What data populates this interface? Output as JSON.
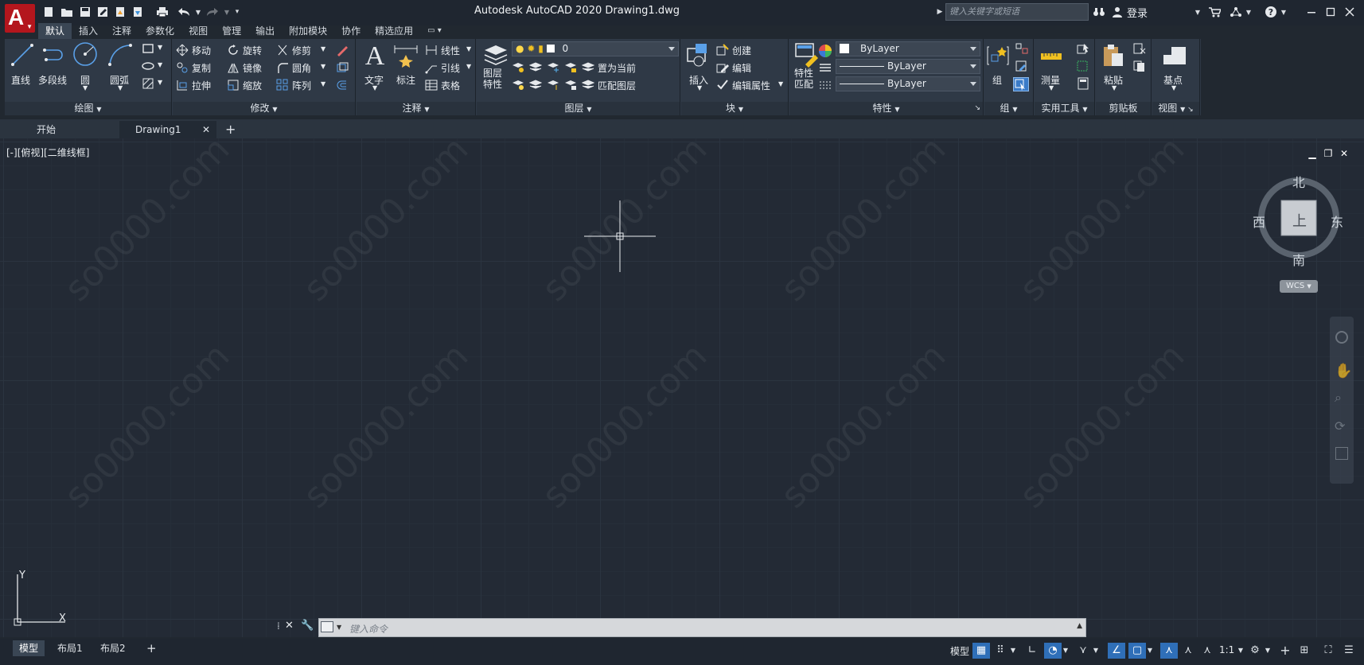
{
  "app": {
    "logo_letter": "A",
    "title": "Autodesk AutoCAD 2020    Drawing1.dwg",
    "search_placeholder": "键入关键字或短语",
    "login": "登录"
  },
  "ribbon_tabs": [
    "默认",
    "插入",
    "注释",
    "参数化",
    "视图",
    "管理",
    "输出",
    "附加模块",
    "协作",
    "精选应用"
  ],
  "draw": {
    "title": "绘图",
    "line": "直线",
    "polyline": "多段线",
    "circle": "圆",
    "arc": "圆弧"
  },
  "modify": {
    "title": "修改",
    "move": "移动",
    "rotate": "旋转",
    "trim": "修剪",
    "copy": "复制",
    "mirror": "镜像",
    "fillet": "圆角",
    "stretch": "拉伸",
    "scale": "缩放",
    "array": "阵列"
  },
  "annotation": {
    "title": "注释",
    "text": "文字",
    "dimension": "标注",
    "linear": "线性",
    "leader": "引线",
    "table": "表格"
  },
  "layers": {
    "title": "图层",
    "properties": "图层\n特性",
    "layer_value": "0",
    "set_current": "置为当前",
    "match_layer": "匹配图层"
  },
  "block": {
    "title": "块",
    "insert": "插入",
    "create": "创建",
    "edit": "编辑",
    "edit_attr": "编辑属性"
  },
  "properties": {
    "title": "特性",
    "match": "特性\n匹配",
    "color": "ByLayer",
    "linetype": "ByLayer",
    "lineweight": "ByLayer"
  },
  "group": {
    "title": "组",
    "group": "组"
  },
  "utilities": {
    "title": "实用工具",
    "measure": "测量"
  },
  "clipboard": {
    "title": "剪贴板",
    "paste": "粘贴"
  },
  "view": {
    "title": "视图",
    "base": "基点"
  },
  "doc_tabs": {
    "start": "开始",
    "drawing": "Drawing1"
  },
  "viewport": {
    "label": "[-][俯视][二维线框]"
  },
  "viewcube": {
    "north": "北",
    "south": "南",
    "east": "东",
    "west": "西",
    "top": "上",
    "wcs": "WCS"
  },
  "ucs": {
    "x": "X",
    "y": "Y"
  },
  "command": {
    "placeholder": "键入命令"
  },
  "layout_tabs": [
    "模型",
    "布局1",
    "布局2"
  ],
  "status": {
    "model": "模型",
    "scale": "1:1"
  },
  "watermark": "so0000.com"
}
